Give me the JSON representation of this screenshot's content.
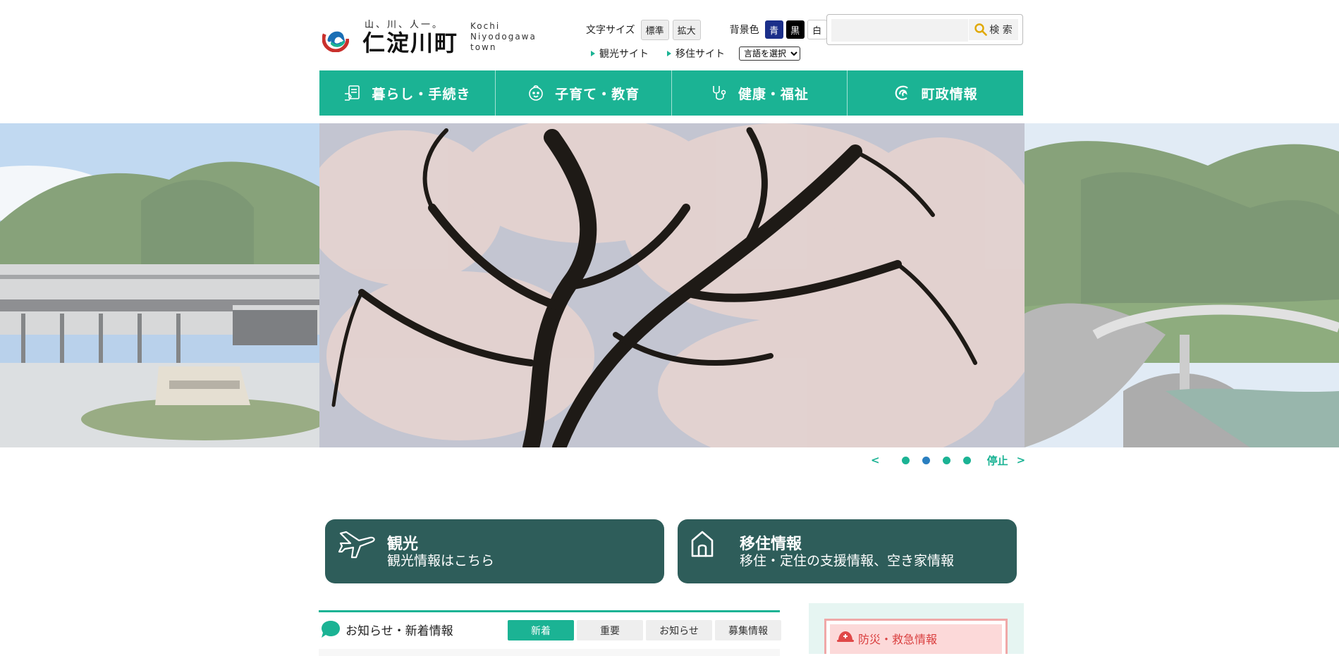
{
  "header": {
    "tagline": "山、川、人一。",
    "town_name": "仁淀川町",
    "town_name_en": "Kochi Niyodogawa town"
  },
  "accessibility": {
    "font_size_label": "文字サイズ",
    "font_standard": "標準",
    "font_large": "拡大",
    "bg_label": "背景色",
    "bg_blue": "青",
    "bg_black": "黒",
    "bg_white": "白"
  },
  "search": {
    "placeholder": "",
    "button_label": "検 索"
  },
  "links": {
    "tourism": "観光サイト",
    "migration": "移住サイト",
    "language": "言語を選択"
  },
  "nav": [
    {
      "label": "暮らし・手続き",
      "icon": "document-hand-icon"
    },
    {
      "label": "子育て・教育",
      "icon": "baby-face-icon"
    },
    {
      "label": "健康・福祉",
      "icon": "stethoscope-icon"
    },
    {
      "label": "町政情報",
      "icon": "town-logo-icon"
    }
  ],
  "slider": {
    "prev": "<",
    "next": ">",
    "stop": "停止",
    "dot_count": 4,
    "active_dot": 2
  },
  "banners": {
    "tourism": {
      "title": "観光",
      "subtitle": "観光情報はこちら",
      "icon": "airplane-icon"
    },
    "migration": {
      "title": "移住情報",
      "subtitle": "移住・定住の支援情報、空き家情報",
      "icon": "house-icon"
    }
  },
  "news": {
    "title": "お知らせ・新着情報",
    "tabs": [
      "新着",
      "重要",
      "お知らせ",
      "募集情報"
    ],
    "active_tab": 0
  },
  "sidebar": {
    "disaster_label": "防災・救急情報"
  },
  "colors": {
    "accent": "#1bb394",
    "banner": "#2e5d5a",
    "disaster": "#d93d3d"
  }
}
